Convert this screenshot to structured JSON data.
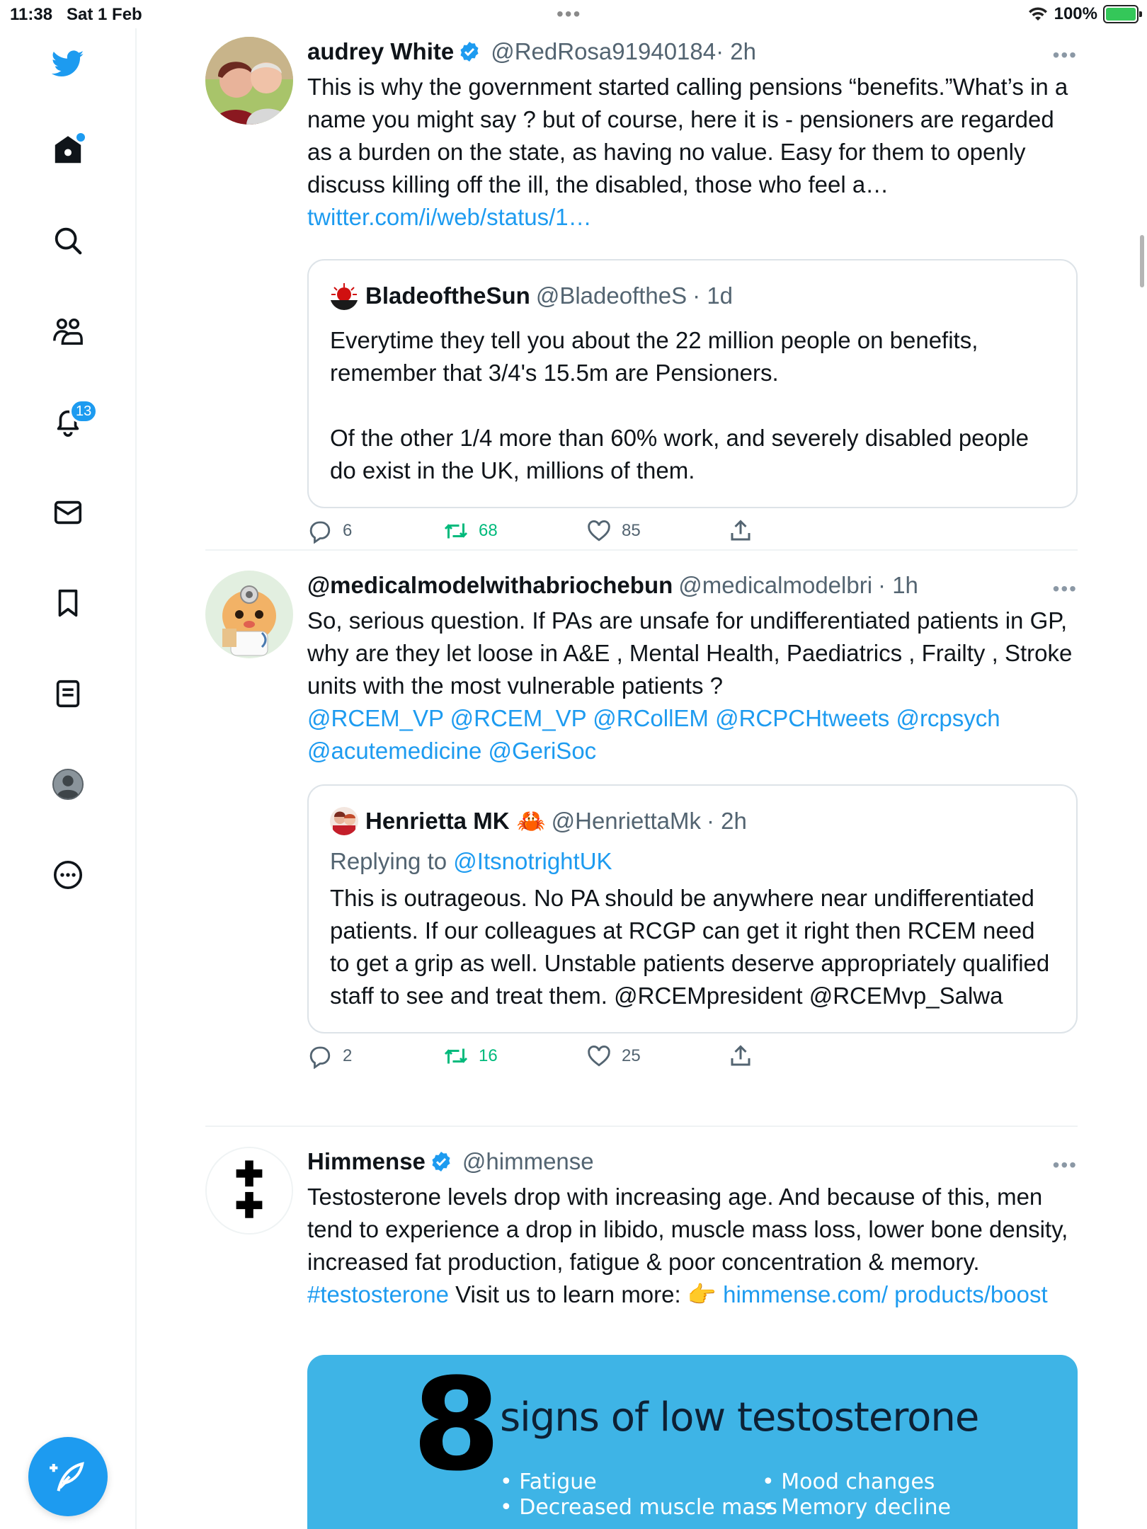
{
  "status_bar": {
    "time": "11:38",
    "date": "Sat 1 Feb",
    "battery": "100%"
  },
  "sidebar": {
    "items": [
      {
        "name": "twitter-logo-icon"
      },
      {
        "name": "home-icon"
      },
      {
        "name": "search-icon"
      },
      {
        "name": "communities-icon"
      },
      {
        "name": "notifications-icon",
        "badge": "13"
      },
      {
        "name": "messages-icon"
      },
      {
        "name": "bookmarks-icon"
      },
      {
        "name": "lists-icon"
      },
      {
        "name": "profile-icon"
      },
      {
        "name": "more-icon"
      }
    ]
  },
  "tweets": [
    {
      "name": "audrey White",
      "handle": "@RedRosa91940184",
      "time": "· 2h",
      "text": "This is why the government started calling pensions “benefits.”What’s in a name you might say ? but of course, here it is - pensioners are regarded as a burden on the state, as having no value. Easy for them to openly discuss killing off the ill, the disabled, those who feel a…",
      "link": "twitter.com/i/web/status/1…",
      "quote": {
        "name": "BladeoftheSun",
        "handle": "@BladeoftheS",
        "time": "· 1d",
        "text1": "Everytime they tell you about the 22 million people on benefits, remember that 3/4's 15.5m are Pensioners.",
        "text2": "Of the other 1/4 more than 60% work, and severely disabled people do exist in the UK, millions of them."
      },
      "replies": "6",
      "retweets": "68",
      "likes": "85"
    },
    {
      "name": "@medicalmodelwithabriochebun",
      "handle": "@medicalmodelbri",
      "time": "· 1h",
      "text": "So, serious question. If PAs are unsafe for undifferentiated patients in GP, why are they let loose in A&E , Mental Health, Paediatrics , Frailty , Stroke units with the most vulnerable patients ?",
      "mentions": "@RCEM_VP @RCEM_VP @RCollEM @RCPCHtweets @rcpsych @acutemedicine @GeriSoc",
      "quote": {
        "name": "Henrietta MK",
        "emoji": "🦀",
        "handle": "@HenriettaMk",
        "time": "· 2h",
        "replying_label": "Replying to",
        "replying_handle": "@ItsnotrightUK",
        "text": "This is outrageous. No PA should be anywhere near undifferentiated patients. If our colleagues at RCGP can get it right then RCEM need to get a grip as well. Unstable patients deserve appropriately qualified staff to see and treat them. @RCEMpresident @RCEMvp_Salwa"
      },
      "replies": "2",
      "retweets": "16",
      "likes": "25"
    },
    {
      "name": "Himmense",
      "handle": "@himmense",
      "text_main": "Testosterone levels drop with increasing age. And because of this, men tend to experience a drop in libido, muscle mass loss, lower bone density, increased fat production, fatigue & poor concentration & memory.",
      "hashtag": "#testosterone",
      "text_after": "Visit us to learn more: 👉",
      "link": "himmense.com/ products/boost",
      "promo": {
        "number": "8",
        "title": "signs of low testosterone",
        "col1": [
          "Fatigue",
          "Decreased muscle mass"
        ],
        "col2": [
          "Mood changes",
          "Memory decline"
        ]
      }
    }
  ]
}
